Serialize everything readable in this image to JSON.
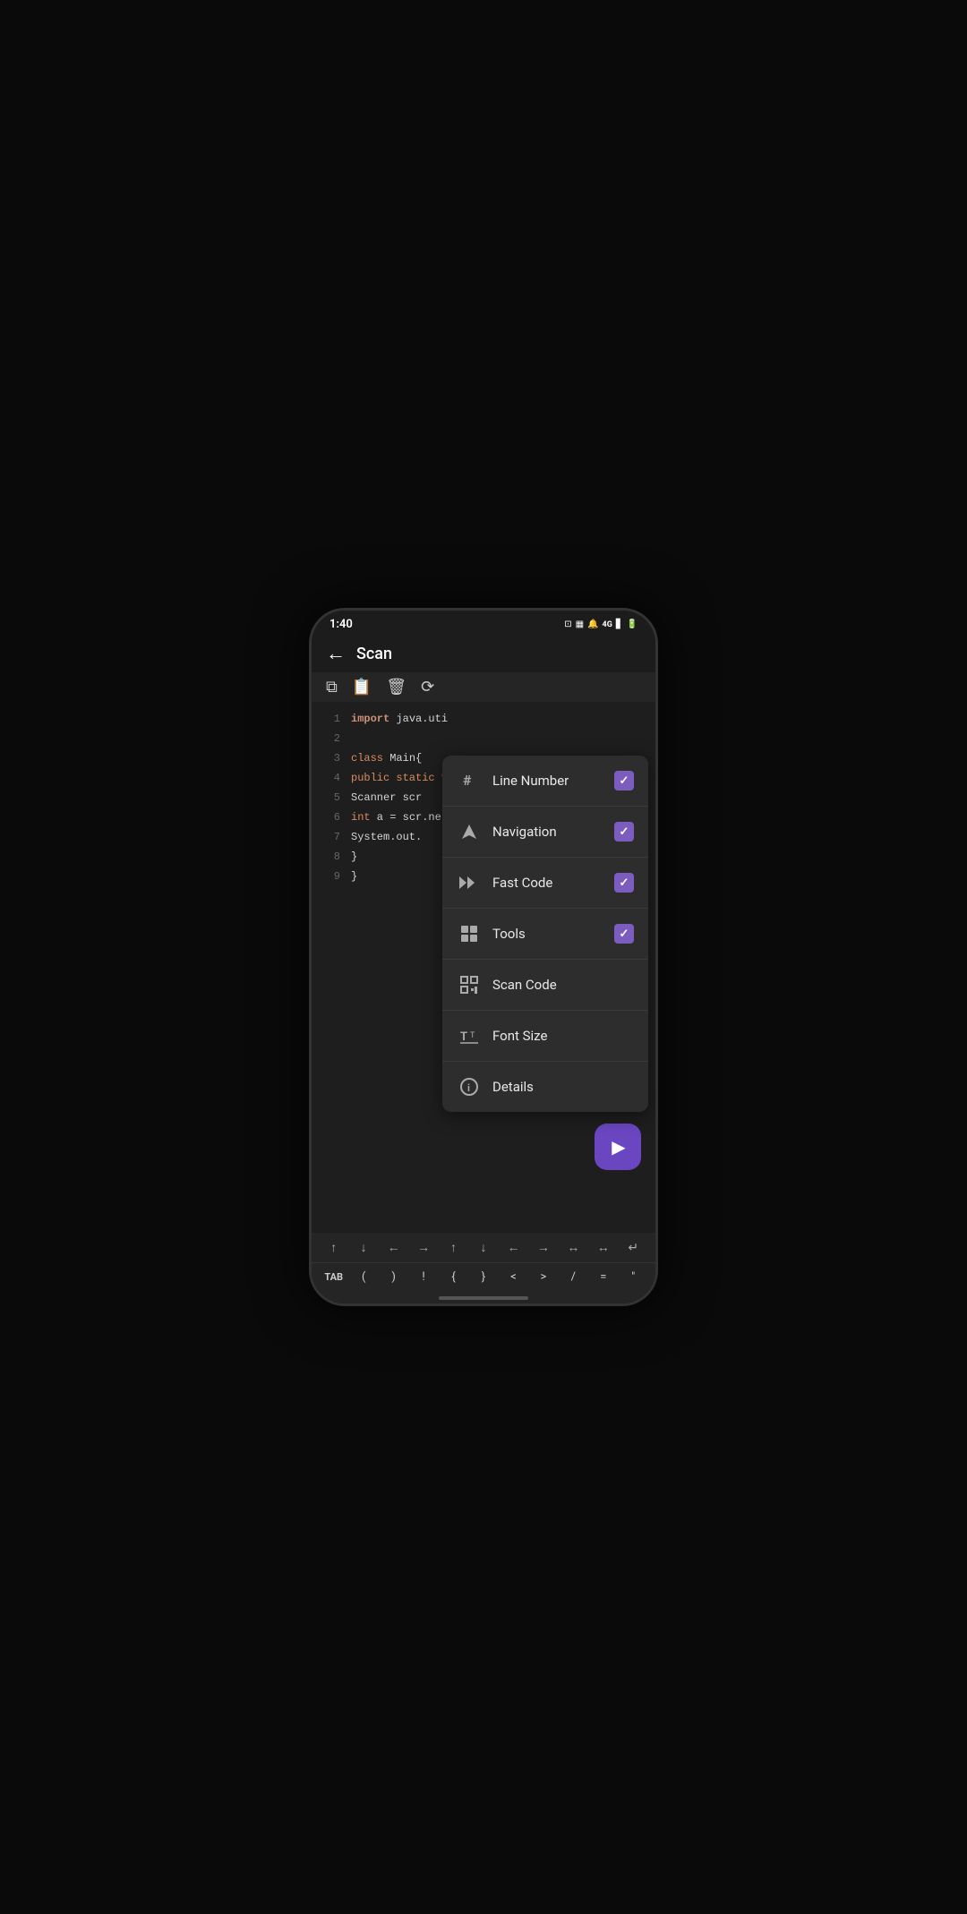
{
  "statusBar": {
    "time": "1:40",
    "icons": [
      "NFC",
      "VOL",
      "MUTE",
      "4G",
      "SIG",
      "BAT"
    ]
  },
  "appBar": {
    "backLabel": "←",
    "title": "Scan"
  },
  "toolbar": {
    "icons": [
      "copy",
      "clipboard",
      "delete",
      "refresh"
    ]
  },
  "editor": {
    "lines": [
      {
        "num": "1",
        "content": "import java.uti"
      },
      {
        "num": "2",
        "content": ""
      },
      {
        "num": "3",
        "content": "class Main{"
      },
      {
        "num": "4",
        "content": "  public static v"
      },
      {
        "num": "5",
        "content": "    Scanner scr"
      },
      {
        "num": "6",
        "content": "    int a = scr.ne"
      },
      {
        "num": "7",
        "content": "    System.out."
      },
      {
        "num": "8",
        "content": "  }"
      },
      {
        "num": "9",
        "content": "}"
      }
    ]
  },
  "menu": {
    "items": [
      {
        "id": "line-number",
        "label": "Line Number",
        "icon": "#",
        "checked": true
      },
      {
        "id": "navigation",
        "label": "Navigation",
        "icon": "▲",
        "checked": true
      },
      {
        "id": "fast-code",
        "label": "Fast Code",
        "icon": "▶▶",
        "checked": true
      },
      {
        "id": "tools",
        "label": "Tools",
        "icon": "⊞",
        "checked": true
      },
      {
        "id": "scan-code",
        "label": "Scan Code",
        "icon": "⊡",
        "checked": false
      },
      {
        "id": "font-size",
        "label": "Font Size",
        "icon": "T↕",
        "checked": false
      },
      {
        "id": "details",
        "label": "Details",
        "icon": "ℹ",
        "checked": false
      }
    ]
  },
  "runButton": {
    "label": "▶"
  },
  "keyboard": {
    "arrowRow": [
      "↑",
      "↓",
      "←",
      "→",
      "↑",
      "↓",
      "←",
      "→",
      "↔",
      "↔",
      "↵"
    ],
    "specialRow": [
      "TAB",
      "(",
      ")",
      "!",
      "{",
      "}",
      "<",
      ">",
      "/",
      "=",
      "\""
    ]
  }
}
